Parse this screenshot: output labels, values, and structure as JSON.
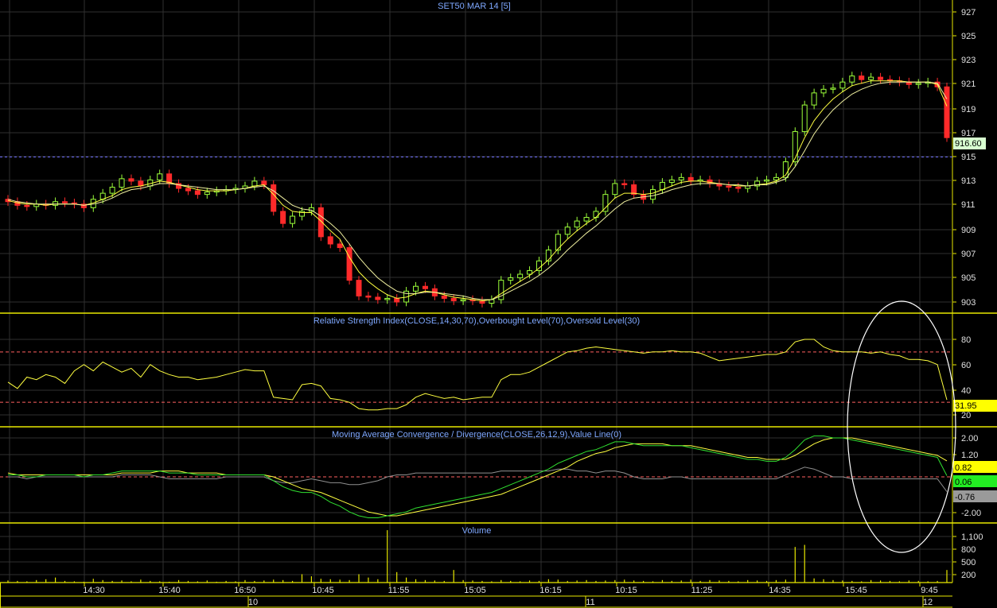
{
  "chart_data": [
    {
      "type": "candlestick",
      "title": "SET50 MAR 14  [5]",
      "yticks": [
        "927",
        "925",
        "923",
        "921",
        "919",
        "917",
        "915",
        "913",
        "911",
        "909",
        "907",
        "905",
        "903"
      ],
      "ylim": [
        902,
        928
      ],
      "last_price": "916.60",
      "reference_line": 915,
      "series": [
        {
          "name": "close",
          "values": [
            911.3,
            911.0,
            910.9,
            911.1,
            911.0,
            911.3,
            911.2,
            911.1,
            910.8,
            911.5,
            912.0,
            912.5,
            913.2,
            913.0,
            912.6,
            913.1,
            913.6,
            912.8,
            912.4,
            912.2,
            911.9,
            912.1,
            912.2,
            912.3,
            912.4,
            912.6,
            913.0,
            912.7,
            910.5,
            909.5,
            910.1,
            910.5,
            910.8,
            908.4,
            907.8,
            907.5,
            904.8,
            903.5,
            903.4,
            903.2,
            903.3,
            903.0,
            903.9,
            904.3,
            904.1,
            903.5,
            903.3,
            903.1,
            903.2,
            903.1,
            902.9,
            903.2,
            904.8,
            905.0,
            905.3,
            905.6,
            906.4,
            907.3,
            908.6,
            909.2,
            909.7,
            910.0,
            910.5,
            911.9,
            912.8,
            912.7,
            911.9,
            911.5,
            912.3,
            912.9,
            913.1,
            913.3,
            913.0,
            913.1,
            912.8,
            912.6,
            912.5,
            912.4,
            912.6,
            913.0,
            913.1,
            913.3,
            914.6,
            917.1,
            919.3,
            920.3,
            920.6,
            920.7,
            921.2,
            921.7,
            921.4,
            921.6,
            921.4,
            921.3,
            921.2,
            921.0,
            921.1,
            921.2,
            920.8,
            916.6
          ]
        },
        {
          "name": "sma_fast",
          "values": [
            911.4,
            911.2,
            911.1,
            911.1,
            911.0,
            911.1,
            911.1,
            911.1,
            911.0,
            911.2,
            911.5,
            911.8,
            912.3,
            912.5,
            912.6,
            912.8,
            913.0,
            912.9,
            912.7,
            912.5,
            912.3,
            912.2,
            912.2,
            912.2,
            912.3,
            912.4,
            912.6,
            912.7,
            911.9,
            911.0,
            910.5,
            910.4,
            910.4,
            909.7,
            908.9,
            908.2,
            906.7,
            905.5,
            904.7,
            904.1,
            903.6,
            903.3,
            903.4,
            903.7,
            903.9,
            903.8,
            903.6,
            903.4,
            903.3,
            903.2,
            903.1,
            903.2,
            903.7,
            904.2,
            904.7,
            905.2,
            905.8,
            906.5,
            907.4,
            908.2,
            908.9,
            909.5,
            910.0,
            910.8,
            911.6,
            912.0,
            912.0,
            911.9,
            912.0,
            912.3,
            912.6,
            912.9,
            913.0,
            913.0,
            912.9,
            912.8,
            912.7,
            912.6,
            912.6,
            912.7,
            912.8,
            913.0,
            913.5,
            914.9,
            916.6,
            918.0,
            919.0,
            919.8,
            920.4,
            920.9,
            921.1,
            921.3,
            921.3,
            921.3,
            921.3,
            921.2,
            921.2,
            921.2,
            921.0,
            919.2
          ]
        },
        {
          "name": "sma_slow",
          "values": [
            911.5,
            911.3,
            911.2,
            911.1,
            911.1,
            911.1,
            911.1,
            911.1,
            911.0,
            911.1,
            911.3,
            911.6,
            912.0,
            912.3,
            912.4,
            912.6,
            912.8,
            912.8,
            912.7,
            912.6,
            912.5,
            912.4,
            912.3,
            912.3,
            912.3,
            912.4,
            912.5,
            912.6,
            912.2,
            911.6,
            911.0,
            910.7,
            910.6,
            910.1,
            909.5,
            908.8,
            907.8,
            906.7,
            905.8,
            905.0,
            904.4,
            903.9,
            903.7,
            903.7,
            903.8,
            903.8,
            903.7,
            903.6,
            903.5,
            903.3,
            903.2,
            903.2,
            903.5,
            903.9,
            904.3,
            904.7,
            905.2,
            905.8,
            906.5,
            907.3,
            908.0,
            908.7,
            909.3,
            910.0,
            910.7,
            911.3,
            911.6,
            911.7,
            911.8,
            912.0,
            912.3,
            912.5,
            912.7,
            912.8,
            912.8,
            912.8,
            912.7,
            912.7,
            912.6,
            912.7,
            912.7,
            912.9,
            913.2,
            914.2,
            915.5,
            916.9,
            918.0,
            918.9,
            919.6,
            920.2,
            920.6,
            920.9,
            921.1,
            921.2,
            921.2,
            921.2,
            921.2,
            921.2,
            921.1,
            919.8
          ]
        }
      ]
    },
    {
      "type": "line",
      "title": "Relative Strength Index(CLOSE,14,30,70),Overbought Level(70),Oversold Level(30)",
      "yticks": [
        "80",
        "60",
        "40",
        "20"
      ],
      "ylim": [
        18,
        88
      ],
      "levels": [
        70,
        30
      ],
      "last_value": "31.95",
      "series": [
        {
          "name": "RSI",
          "values": [
            46,
            41,
            50,
            48,
            52,
            50,
            45,
            55,
            60,
            55,
            62,
            58,
            54,
            57,
            50,
            60,
            55,
            52,
            50,
            50,
            48,
            49,
            50,
            52,
            54,
            56,
            55,
            55,
            34,
            33,
            32,
            44,
            45,
            43,
            33,
            32,
            30,
            25,
            24,
            24,
            25,
            25,
            28,
            34,
            37,
            35,
            33,
            34,
            32,
            33,
            34,
            34,
            48,
            52,
            52,
            54,
            58,
            62,
            66,
            70,
            71,
            73,
            74,
            73,
            72,
            71,
            70,
            69,
            70,
            70,
            71,
            70,
            70,
            69,
            66,
            63,
            64,
            65,
            66,
            67,
            68,
            68,
            70,
            78,
            80,
            80,
            74,
            71,
            70,
            70,
            70,
            69,
            70,
            68,
            67,
            64,
            64,
            63,
            60,
            31.95
          ]
        }
      ]
    },
    {
      "type": "line",
      "title": "Moving Average Convergence / Divergence(CLOSE,26,12,9),Value Line(0)",
      "yticks": [
        "2.00",
        "1.20",
        "-2.00"
      ],
      "ylim": [
        -2.5,
        2.5
      ],
      "levels": [
        0
      ],
      "last_values": [
        "0.82",
        "0.06",
        "-0.76"
      ],
      "series": [
        {
          "name": "MACD",
          "values": [
            0.1,
            0.1,
            0.0,
            0.0,
            0.1,
            0.1,
            0.1,
            0.1,
            0.0,
            0.1,
            0.1,
            0.2,
            0.3,
            0.3,
            0.3,
            0.3,
            0.3,
            0.2,
            0.2,
            0.2,
            0.1,
            0.1,
            0.1,
            0.1,
            0.1,
            0.1,
            0.1,
            0.1,
            -0.2,
            -0.5,
            -0.7,
            -0.8,
            -0.8,
            -1.0,
            -1.3,
            -1.5,
            -1.8,
            -2.0,
            -2.1,
            -2.1,
            -2.0,
            -1.9,
            -1.8,
            -1.6,
            -1.5,
            -1.4,
            -1.3,
            -1.2,
            -1.1,
            -1.0,
            -0.9,
            -0.8,
            -0.6,
            -0.4,
            -0.2,
            0.0,
            0.2,
            0.4,
            0.7,
            0.9,
            1.1,
            1.3,
            1.4,
            1.6,
            1.8,
            1.8,
            1.7,
            1.6,
            1.6,
            1.6,
            1.6,
            1.6,
            1.5,
            1.4,
            1.3,
            1.2,
            1.1,
            1.0,
            0.9,
            0.9,
            0.8,
            0.8,
            1.0,
            1.4,
            1.9,
            2.1,
            2.1,
            2.0,
            2.0,
            1.9,
            1.8,
            1.7,
            1.6,
            1.5,
            1.4,
            1.3,
            1.2,
            1.1,
            1.0,
            0.06
          ]
        },
        {
          "name": "Signal",
          "values": [
            0.2,
            0.1,
            0.1,
            0.1,
            0.1,
            0.1,
            0.1,
            0.1,
            0.1,
            0.1,
            0.1,
            0.1,
            0.2,
            0.2,
            0.2,
            0.2,
            0.3,
            0.3,
            0.3,
            0.2,
            0.2,
            0.2,
            0.2,
            0.1,
            0.1,
            0.1,
            0.1,
            0.1,
            0.0,
            -0.2,
            -0.4,
            -0.6,
            -0.7,
            -0.8,
            -1.0,
            -1.2,
            -1.4,
            -1.6,
            -1.8,
            -1.9,
            -2.0,
            -2.0,
            -1.9,
            -1.8,
            -1.7,
            -1.6,
            -1.5,
            -1.4,
            -1.3,
            -1.2,
            -1.1,
            -1.0,
            -0.9,
            -0.7,
            -0.5,
            -0.3,
            -0.1,
            0.1,
            0.3,
            0.5,
            0.8,
            1.0,
            1.2,
            1.3,
            1.5,
            1.6,
            1.7,
            1.7,
            1.7,
            1.7,
            1.6,
            1.6,
            1.6,
            1.5,
            1.4,
            1.3,
            1.2,
            1.1,
            1.0,
            1.0,
            0.9,
            0.9,
            0.9,
            1.1,
            1.4,
            1.7,
            1.9,
            2.0,
            2.0,
            2.0,
            1.9,
            1.8,
            1.7,
            1.6,
            1.5,
            1.4,
            1.3,
            1.2,
            1.1,
            0.82
          ]
        },
        {
          "name": "Histogram",
          "values": [
            0.0,
            0.0,
            -0.1,
            0.0,
            0.0,
            0.0,
            0.0,
            0.0,
            0.0,
            0.0,
            0.0,
            0.0,
            0.1,
            0.1,
            0.1,
            0.1,
            0.0,
            -0.1,
            -0.1,
            -0.1,
            -0.1,
            -0.1,
            -0.1,
            0.0,
            0.0,
            0.0,
            0.0,
            0.0,
            -0.2,
            -0.3,
            -0.3,
            -0.2,
            -0.1,
            -0.2,
            -0.3,
            -0.3,
            -0.4,
            -0.4,
            -0.3,
            -0.2,
            0.0,
            0.1,
            0.1,
            0.2,
            0.2,
            0.2,
            0.2,
            0.2,
            0.2,
            0.2,
            0.2,
            0.2,
            0.3,
            0.3,
            0.3,
            0.3,
            0.3,
            0.3,
            0.4,
            0.4,
            0.3,
            0.3,
            0.2,
            0.3,
            0.3,
            0.2,
            0.0,
            -0.1,
            -0.1,
            -0.1,
            0.0,
            0.0,
            -0.1,
            -0.1,
            -0.1,
            -0.1,
            -0.1,
            -0.1,
            -0.1,
            -0.1,
            -0.1,
            -0.1,
            0.1,
            0.3,
            0.5,
            0.4,
            0.2,
            0.0,
            0.0,
            -0.1,
            -0.1,
            -0.1,
            -0.1,
            -0.1,
            -0.1,
            -0.1,
            -0.1,
            -0.1,
            -0.1,
            -0.76
          ]
        }
      ]
    },
    {
      "type": "bar",
      "title": "Volume",
      "yticks": [
        "1,100",
        "800",
        "500",
        "200"
      ],
      "ylim": [
        0,
        1300
      ],
      "series": [
        {
          "name": "Volume",
          "values": [
            50,
            40,
            30,
            60,
            80,
            120,
            40,
            30,
            20,
            90,
            60,
            40,
            50,
            30,
            70,
            40,
            30,
            20,
            60,
            40,
            30,
            50,
            20,
            40,
            30,
            60,
            40,
            50,
            70,
            60,
            40,
            200,
            150,
            90,
            80,
            70,
            60,
            200,
            120,
            80,
            1250,
            250,
            120,
            80,
            60,
            50,
            40,
            300,
            60,
            50,
            40,
            30,
            60,
            40,
            30,
            50,
            40,
            80,
            70,
            40,
            50,
            60,
            40,
            50,
            60,
            70,
            50,
            40,
            30,
            60,
            40,
            50,
            70,
            40,
            60,
            50,
            40,
            30,
            60,
            50,
            40,
            60,
            70,
            850,
            900,
            100,
            80,
            60,
            50,
            40,
            30,
            60,
            50,
            40,
            30,
            50,
            40,
            30,
            40,
            300
          ]
        }
      ]
    }
  ],
  "x_axis": {
    "time_labels": [
      "14:30",
      "15:40",
      "16:50",
      "10:45",
      "11:55",
      "15:05",
      "16:15",
      "10:15",
      "11:25",
      "14:35",
      "15:45",
      "9:45"
    ],
    "date_labels": [
      "10",
      "11",
      "12"
    ]
  }
}
